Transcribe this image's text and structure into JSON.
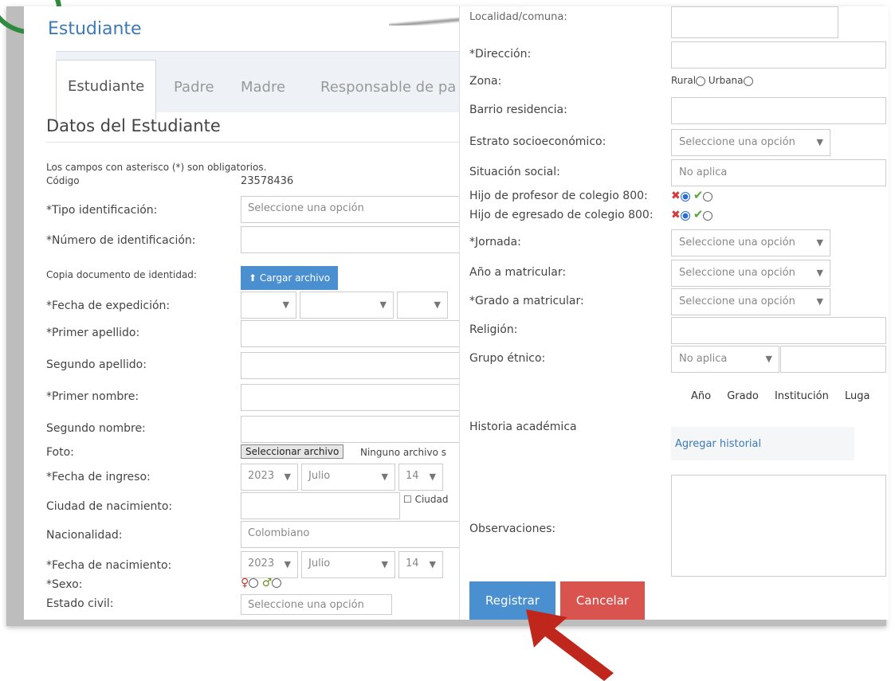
{
  "app_title": "Estudiante",
  "tabs": [
    "Estudiante",
    "Padre",
    "Madre",
    "Responsable de pa"
  ],
  "section_title": "Datos del Estudiante",
  "required_note": "Los campos con asterisco (*) son obligatorios.",
  "left_fields": {
    "codigo_label": "Código",
    "codigo_value": "23578436",
    "tipo_id_label": "*Tipo identificación:",
    "tipo_id_value": "Seleccione una opción",
    "numero_id_label": "*Número de identificación:",
    "copia_doc_label": "Copia documento de identidad:",
    "cargar_archivo": "Cargar archivo",
    "fecha_exp_label": "*Fecha de expedición:",
    "primer_apellido_label": "*Primer apellido:",
    "segundo_apellido_label": "Segundo apellido:",
    "primer_nombre_label": "*Primer nombre:",
    "segundo_nombre_label": "Segundo nombre:",
    "foto_label": "Foto:",
    "seleccionar_archivo": "Seleccionar archivo",
    "ninguno_archivo": "Ninguno archivo s",
    "fecha_ingreso_label": "*Fecha de ingreso:",
    "fecha_ingreso_year": "2023",
    "fecha_ingreso_month": "Julio",
    "fecha_ingreso_day": "14",
    "ciudad_nac_label": "Ciudad de nacimiento:",
    "ciudad_checkbox": "Ciudad",
    "nacionalidad_label": "Nacionalidad:",
    "nacionalidad_value": "Colombiano",
    "fecha_nac_label": "*Fecha de nacimiento:",
    "fecha_nac_year": "2023",
    "fecha_nac_month": "Julio",
    "fecha_nac_day": "14",
    "sexo_label": "*Sexo:",
    "estado_civil_label": "Estado civil:",
    "estado_civil_value": "Seleccione una opción"
  },
  "right_fields": {
    "ciudad_comuna_label": "Localidad/comuna:",
    "direccion_label": "*Dirección:",
    "zona_label": "Zona:",
    "zona_rural": "Rural",
    "zona_urbana": "Urbana",
    "barrio_label": "Barrio residencia:",
    "estrato_label": "Estrato socioeconómico:",
    "estrato_value": "Seleccione una opción",
    "situacion_label": "Situación social:",
    "situacion_value": "No aplica",
    "hijo_profesor_label": "Hijo de profesor de colegio 800:",
    "hijo_egresado_label": "Hijo de egresado de colegio 800:",
    "jornada_label": "*Jornada:",
    "jornada_value": "Seleccione una opción",
    "anio_label": "Año a matricular:",
    "anio_value": "Seleccione una opción",
    "grado_label": "*Grado a matricular:",
    "grado_value": "Seleccione una opción",
    "religion_label": "Religión:",
    "grupo_label": "Grupo étnico:",
    "grupo_value": "No aplica",
    "historia_label": "Historia académica",
    "hist_cols": [
      "Año",
      "Grado",
      "Institución",
      "Luga"
    ],
    "agregar_historial": "Agregar historial",
    "observaciones_label": "Observaciones:",
    "registrar": "Registrar",
    "cancelar": "Cancelar"
  },
  "colors": {
    "accent": "#4a8fcf",
    "cancel": "#d9534f",
    "arrow": "#c0271c",
    "title": "#3d7ab5"
  }
}
